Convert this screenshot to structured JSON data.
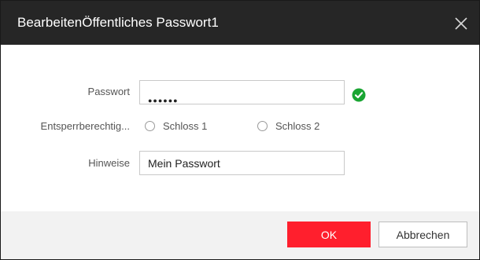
{
  "dialog": {
    "title": "BearbeitenÖffentliches Passwort1"
  },
  "form": {
    "password": {
      "label": "Passwort",
      "masked_value": "●●●●●●",
      "valid_icon": "check-circle-icon",
      "valid_color": "#1aa533"
    },
    "unlock_permission": {
      "label": "Entsperrberechtig...",
      "options": [
        {
          "label": "Schloss 1",
          "checked": false
        },
        {
          "label": "Schloss 2",
          "checked": false
        }
      ]
    },
    "hint": {
      "label": "Hinweise",
      "value": "Mein Passwort"
    }
  },
  "buttons": {
    "ok_label": "OK",
    "cancel_label": "Abbrechen"
  },
  "colors": {
    "titlebar": "#262626",
    "primary": "#ff1f2d",
    "footer": "#f2f2f2"
  }
}
